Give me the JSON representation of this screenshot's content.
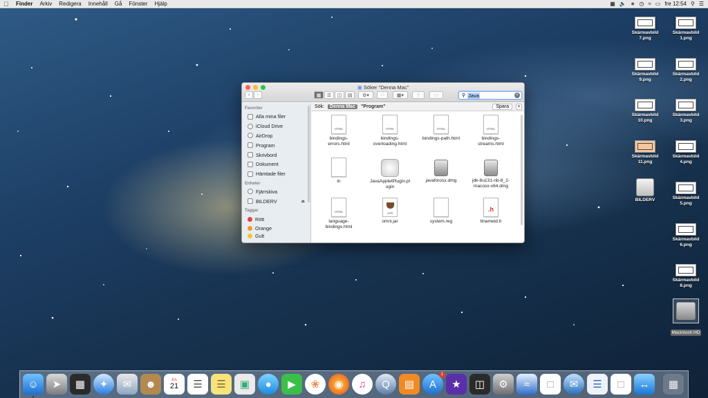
{
  "menubar": {
    "items": [
      "Finder",
      "Arkiv",
      "Redigera",
      "Innehåll",
      "Gå",
      "Fönster",
      "Hjälp"
    ],
    "clock": "fre 12:54"
  },
  "desktop": {
    "icons": [
      {
        "label": "Skärmavbild 7.png"
      },
      {
        "label": "Skärmavbild 1.png"
      },
      {
        "label": "Skärmavbild 9.png"
      },
      {
        "label": "Skärmavbild 2.png"
      },
      {
        "label": "Skärmavbild 10.png"
      },
      {
        "label": "Skärmavbild 3.png"
      },
      {
        "label": "Skärmavbild 11.png"
      },
      {
        "label": "Skärmavbild 4.png"
      },
      {
        "label": "BILDERV"
      },
      {
        "label": "Skärmavbild 5.png"
      },
      {
        "label": "Skärmavbild 6.png"
      },
      {
        "label": "Skärmavbild 8.png"
      },
      {
        "label": "Macintosh HD"
      }
    ]
  },
  "finder": {
    "title": "Söker \"Denna Mac\"",
    "search_query": "Java",
    "scope": {
      "label": "Sök:",
      "selected": "Denna Mac",
      "other": "\"Program\"",
      "save": "Spara",
      "add": "+"
    },
    "sidebar": {
      "favorites_header": "Favoriter",
      "favorites": [
        "Alla mina filer",
        "iCloud Drive",
        "AirDrop",
        "Program",
        "Skrivbord",
        "Dokument",
        "Hämtade filer"
      ],
      "devices_header": "Enheter",
      "devices": [
        "Fjärrskiva",
        "BILDERV"
      ],
      "tags_header": "Taggar",
      "tags": [
        {
          "name": "Rött",
          "color": "#e0443a"
        },
        {
          "name": "Orange",
          "color": "#f39a2b"
        },
        {
          "name": "Gult",
          "color": "#f4c531"
        }
      ]
    },
    "files": [
      {
        "name": "bindings-errors.html",
        "line1": "bindings-",
        "line2": "errors.html",
        "kind": "HTML"
      },
      {
        "name": "bindings-overloading.html",
        "line1": "bindings-",
        "line2": "overloading.html",
        "kind": "HTML"
      },
      {
        "name": "bindings-path.html",
        "line1": "bindings-path.html",
        "line2": "",
        "kind": "HTML"
      },
      {
        "name": "bindings-streams.html",
        "line1": "bindings-",
        "line2": "streams.html",
        "kind": "HTML"
      },
      {
        "name": "in",
        "line1": "in",
        "line2": "",
        "kind": "doc"
      },
      {
        "name": "JavaAppletPlugin.plugin",
        "line1": "JavaAppletPlugin.pl",
        "line2": "ugin",
        "kind": "pkg"
      },
      {
        "name": "javaforosx.dmg",
        "line1": "javaforosx.dmg",
        "line2": "",
        "kind": "dmg"
      },
      {
        "name": "jdk-8u131-nb-8_2-macosx-x64.dmg",
        "line1": "jdk-8u131-nb-8_2-",
        "line2": "macosx-x64.dmg",
        "kind": "dmg"
      },
      {
        "name": "language-bindings.html",
        "line1": "language-",
        "line2": "bindings.html",
        "kind": "HTML"
      },
      {
        "name": "omni.jar",
        "line1": "omni.jar",
        "line2": "",
        "kind": "JAR"
      },
      {
        "name": "system.reg",
        "line1": "system.reg",
        "line2": "",
        "kind": "doc"
      },
      {
        "name": "ttnameid.h",
        "line1": "ttnameid.h",
        "line2": "",
        "kind": ".h"
      }
    ]
  },
  "dock": {
    "badge_appstore": "1",
    "calendar_day": "21",
    "calendar_month": "JUL"
  }
}
